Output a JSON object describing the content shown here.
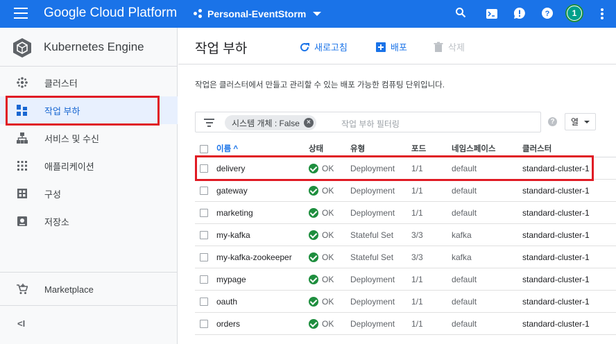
{
  "topbar": {
    "brand": "Google Cloud Platform",
    "project": "Personal-EventStorm",
    "avatar_letter": "1",
    "icons": [
      "search-icon",
      "cloud-shell-icon",
      "notifications-icon",
      "help-icon",
      "more-vert-icon"
    ]
  },
  "sidebar": {
    "product_name": "Kubernetes Engine",
    "items": [
      {
        "label": "클러스터",
        "icon": "clusters-icon"
      },
      {
        "label": "작업 부하",
        "icon": "workloads-icon"
      },
      {
        "label": "서비스 및 수신",
        "icon": "services-icon"
      },
      {
        "label": "애플리케이션",
        "icon": "applications-icon"
      },
      {
        "label": "구성",
        "icon": "configuration-icon"
      },
      {
        "label": "저장소",
        "icon": "storage-icon"
      }
    ],
    "marketplace": "Marketplace",
    "collapse": "<I"
  },
  "main": {
    "title": "작업 부하",
    "actions": {
      "refresh": "새로고침",
      "deploy": "배포",
      "delete": "삭제"
    },
    "description": "작업은 클러스터에서 만들고 관리할 수 있는 배포 가능한 컴퓨팅 단위입니다.",
    "filter": {
      "chip": "시스템 개체 : False",
      "placeholder": "작업 부하 필터링"
    },
    "help": "?",
    "columns_button": "열"
  },
  "table": {
    "headers": {
      "name": "이름 ^",
      "status": "상태",
      "type": "유형",
      "pods": "포드",
      "namespace": "네임스페이스",
      "cluster": "클러스터"
    },
    "rows": [
      {
        "name": "delivery",
        "status": "OK",
        "type": "Deployment",
        "pods": "1/1",
        "namespace": "default",
        "cluster": "standard-cluster-1"
      },
      {
        "name": "gateway",
        "status": "OK",
        "type": "Deployment",
        "pods": "1/1",
        "namespace": "default",
        "cluster": "standard-cluster-1"
      },
      {
        "name": "marketing",
        "status": "OK",
        "type": "Deployment",
        "pods": "1/1",
        "namespace": "default",
        "cluster": "standard-cluster-1"
      },
      {
        "name": "my-kafka",
        "status": "OK",
        "type": "Stateful Set",
        "pods": "3/3",
        "namespace": "kafka",
        "cluster": "standard-cluster-1"
      },
      {
        "name": "my-kafka-zookeeper",
        "status": "OK",
        "type": "Stateful Set",
        "pods": "3/3",
        "namespace": "kafka",
        "cluster": "standard-cluster-1"
      },
      {
        "name": "mypage",
        "status": "OK",
        "type": "Deployment",
        "pods": "1/1",
        "namespace": "default",
        "cluster": "standard-cluster-1"
      },
      {
        "name": "oauth",
        "status": "OK",
        "type": "Deployment",
        "pods": "1/1",
        "namespace": "default",
        "cluster": "standard-cluster-1"
      },
      {
        "name": "orders",
        "status": "OK",
        "type": "Deployment",
        "pods": "1/1",
        "namespace": "default",
        "cluster": "standard-cluster-1"
      }
    ]
  },
  "colors": {
    "topbar": "#1a73e8",
    "highlight": "#e01b24",
    "status_ok": "#1e8e3e"
  }
}
